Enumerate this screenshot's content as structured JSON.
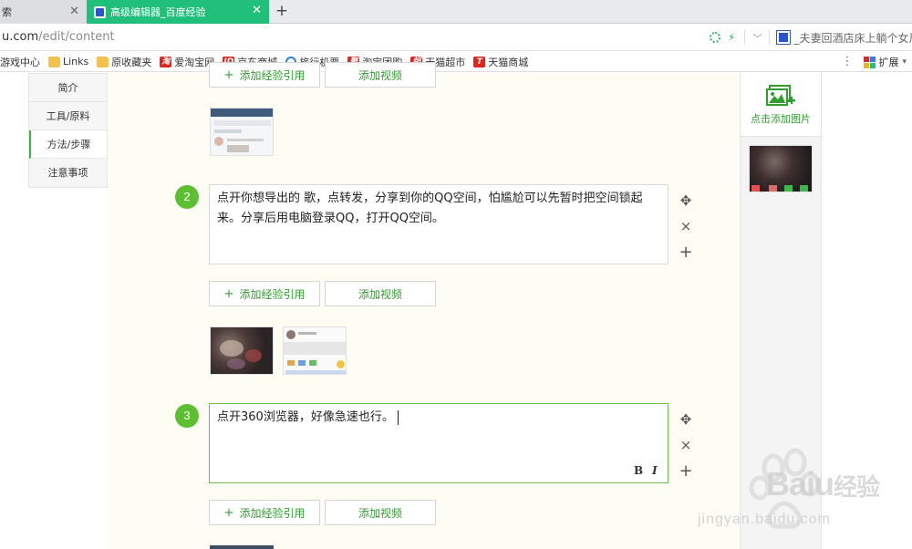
{
  "tabs": [
    {
      "label": "索",
      "active": false
    },
    {
      "label": "高级编辑器_百度经验",
      "active": true
    }
  ],
  "new_tab_symbol": "+",
  "address": {
    "domain": "u.com",
    "path": "/edit/content"
  },
  "hot_search": "_夫妻回酒店床上躺个女尸",
  "bookmarks": [
    {
      "label": "游戏中心",
      "icon": "none"
    },
    {
      "label": "Links",
      "icon": "folder-icon"
    },
    {
      "label": "原收藏夹",
      "icon": "folder-icon"
    },
    {
      "label": "爱淘宝网",
      "icon": "taobao-icon"
    },
    {
      "label": "京东商城",
      "icon": "jd-icon"
    },
    {
      "label": "旅行机票",
      "icon": "travel-icon"
    },
    {
      "label": "淘宝团购",
      "icon": "juhuasuan-icon"
    },
    {
      "label": "天猫超市",
      "icon": "tmall-market-icon"
    },
    {
      "label": "天猫商城",
      "icon": "tmall-icon"
    }
  ],
  "extensions_label": "扩展",
  "sidenav": [
    "简介",
    "工具/原料",
    "方法/步骤",
    "注意事项"
  ],
  "active_nav": "方法/步骤",
  "buttons": {
    "add_reference": "添加经验引用",
    "add_video": "添加视频"
  },
  "steps": [
    {
      "number": "2",
      "text": "点开你想导出的 歌，点转发，分享到你的QQ空间，怕尴尬可以先暂时把空间锁起来。分享后用电脑登录QQ，打开QQ空间。"
    },
    {
      "number": "3",
      "text": "点开360浏览器，好像急速也行。"
    }
  ],
  "format_tools": {
    "bold": "B",
    "italic": "I"
  },
  "step_tools": {
    "move": "✥",
    "delete": "×",
    "add": "+"
  },
  "right_panel": {
    "add_image_label": "点击添加图片"
  },
  "watermark": {
    "brand": "Bai",
    "brand_tail": "u",
    "cn": "经验",
    "url": "jingyan.baidu.com"
  },
  "colors": {
    "accent_green": "#5cbf32",
    "tab_green": "#21c07a",
    "content_bg": "#fdfdf3"
  }
}
